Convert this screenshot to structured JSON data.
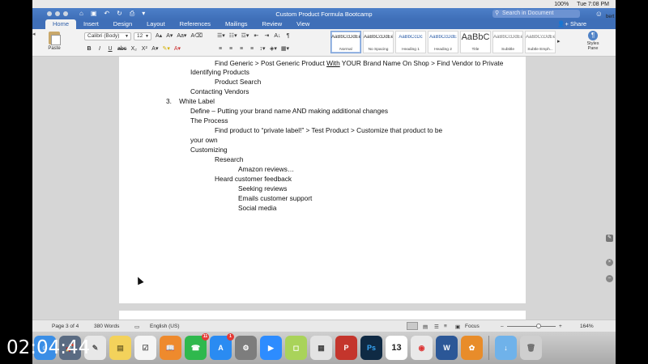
{
  "menubar": {
    "battery": "100%",
    "clock": "Tue 7:08 PM"
  },
  "window": {
    "title": "Custom Product Formula Bootcamp",
    "search_placeholder": "Search in Document",
    "share_label": "Share",
    "user_fragment": "bert"
  },
  "tabs": [
    {
      "label": "Home"
    },
    {
      "label": "Insert"
    },
    {
      "label": "Design"
    },
    {
      "label": "Layout"
    },
    {
      "label": "References"
    },
    {
      "label": "Mailings"
    },
    {
      "label": "Review"
    },
    {
      "label": "View"
    }
  ],
  "ribbon": {
    "paste_label": "Paste",
    "font_name": "Calibri (Body)",
    "font_size": "12",
    "styles": [
      {
        "sample": "AaBbCcDdEe",
        "name": "Normal"
      },
      {
        "sample": "AaBbCcDdEe",
        "name": "No Spacing"
      },
      {
        "sample": "AaBbCcDc",
        "name": "Heading 1"
      },
      {
        "sample": "AaBbCcDdE",
        "name": "Heading 2"
      },
      {
        "sample": "AaBbC",
        "name": "Title"
      },
      {
        "sample": "AaBbCcDdEe",
        "name": "Subtitle"
      },
      {
        "sample": "AaBbCcDdEe",
        "name": "Subtle Emph..."
      }
    ],
    "styles_pane_label": "Styles Pane"
  },
  "document": {
    "lines": [
      {
        "text": "Find Generic > Post Generic Product ",
        "underline": "With",
        "rest": " YOUR Brand Name On Shop > Find Vendor to Private"
      },
      {
        "text": "Identifying Products"
      },
      {
        "text": "Product Search"
      },
      {
        "text": "Contacting Vendors"
      },
      {
        "text": "3.    White Label"
      },
      {
        "text": "Define – Putting your brand name AND making additional changes"
      },
      {
        "text": "The Process"
      },
      {
        "text": "Find product to “private label!” > Test Product > Customize that product to be"
      },
      {
        "text": "your own"
      },
      {
        "text": "Customizing"
      },
      {
        "text": "Research"
      },
      {
        "text": "Amazon reviews…"
      },
      {
        "text": "Heard customer feedback"
      },
      {
        "text": "Seeking reviews"
      },
      {
        "text": "Emails customer support"
      },
      {
        "text": "Social media"
      }
    ]
  },
  "status": {
    "page": "Page 3 of 4",
    "words": "380 Words",
    "language": "English (US)",
    "focus": "Focus",
    "zoom": "164%"
  },
  "dock": {
    "badges": {
      "facetime": "11",
      "appstore": "1"
    },
    "calendar_day": "13"
  },
  "overlay": {
    "timer": "02:04:44"
  }
}
